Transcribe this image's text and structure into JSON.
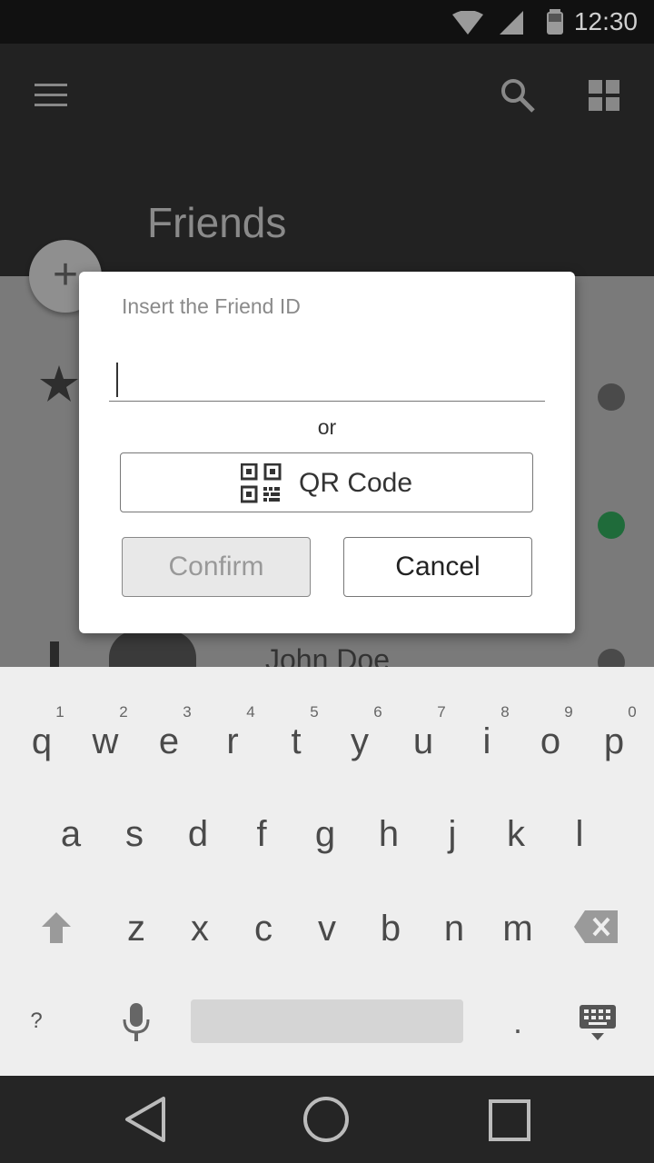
{
  "status_bar": {
    "time": "12:30"
  },
  "app_bar": {
    "title": "Friends"
  },
  "list": {
    "visible_contact_name": "John Doe",
    "status_colors": [
      "#4a4a4a",
      "#1f6b3a",
      "#4a4a4a"
    ]
  },
  "dialog": {
    "prompt": "Insert the Friend ID",
    "input_value": "",
    "or_label": "or",
    "qr_label": "QR Code",
    "confirm_label": "Confirm",
    "cancel_label": "Cancel"
  },
  "keyboard": {
    "row1": [
      "q",
      "w",
      "e",
      "r",
      "t",
      "y",
      "u",
      "i",
      "o",
      "p"
    ],
    "row1_numbers": [
      "1",
      "2",
      "3",
      "4",
      "5",
      "6",
      "7",
      "8",
      "9",
      "0"
    ],
    "row2": [
      "a",
      "s",
      "d",
      "f",
      "g",
      "h",
      "j",
      "k",
      "l"
    ],
    "row3": [
      "z",
      "x",
      "c",
      "v",
      "b",
      "n",
      "m"
    ],
    "symbols_key": "?",
    "period_key": "."
  },
  "colors": {
    "scrim": "#7a7a7a",
    "keyboard_bg": "#eeeeee",
    "online": "#1f6b3a"
  }
}
